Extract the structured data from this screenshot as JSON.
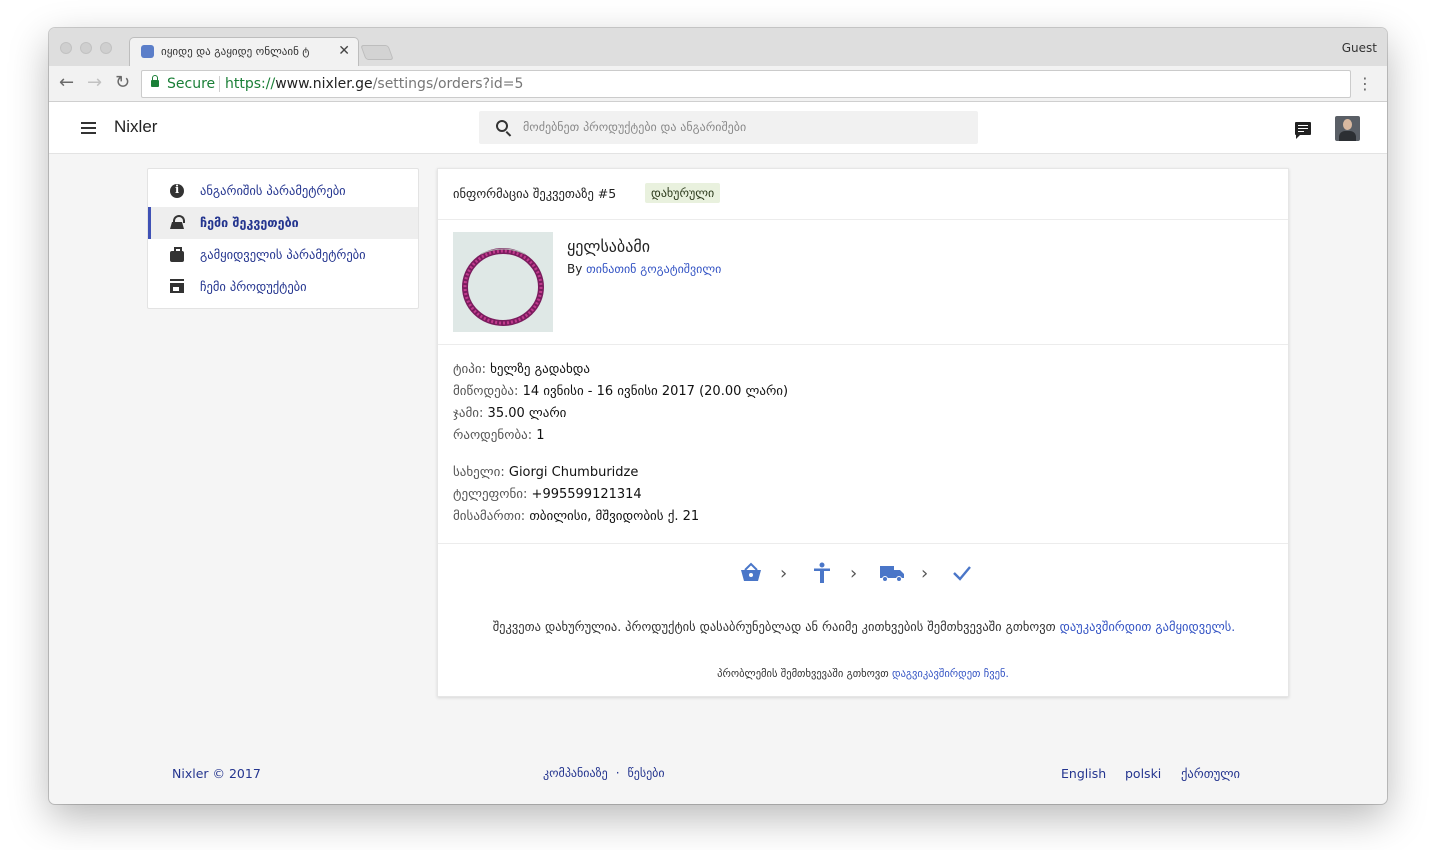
{
  "browser": {
    "tab_title": "იყიდე და გაყიდე ონლაინ ტ",
    "guest_label": "Guest",
    "secure_label": "Secure",
    "url_scheme": "https://",
    "url_host": "www.nixler.ge",
    "url_path": "/settings/orders?id=5"
  },
  "app": {
    "brand": "Nixler",
    "search_placeholder": "მოძებნეთ პროდუქტები და ანგარიშები"
  },
  "sidebar": {
    "items": [
      {
        "label": "ანგარიშის პარამეტრები",
        "icon": "info-icon",
        "active": false
      },
      {
        "label": "ჩემი შეკვეთები",
        "icon": "basket-icon",
        "active": true
      },
      {
        "label": "გამყიდველის პარამეტრები",
        "icon": "briefcase-icon",
        "active": false
      },
      {
        "label": "ჩემი პროდუქტები",
        "icon": "store-icon",
        "active": false
      }
    ]
  },
  "order": {
    "title": "ინფორმაცია შეკვეთაზე #5",
    "status": "დახურული",
    "product_name": "ყელსაბამი",
    "by_label": "By",
    "seller": "თინათინ გოგატიშვილი",
    "type_label": "ტიპი:",
    "type_value": "ხელზე გადახდა",
    "delivery_label": "მიწოდება:",
    "delivery_value": "14 ივნისი - 16 ივნისი 2017 (20.00 ლარი)",
    "total_label": "ჯამი:",
    "total_value": "35.00 ლარი",
    "quantity_label": "რაოდენობა:",
    "quantity_value": "1",
    "name_label": "სახელი:",
    "name_value": "Giorgi Chumburidze",
    "phone_label": "ტელეფონი:",
    "phone_value": "+995599121314",
    "address_label": "მისამართი:",
    "address_value": "თბილისი, მშვიდობის ქ. 21",
    "closed_note": "შეკვეთა დახურულია. პროდუქტის დასაბრუნებლად ან რაიმე კითხვების შემთხვევაში გთხოვთ",
    "contact_seller_link": "დაუკავშირდით გამყიდველს.",
    "help_note": "პრობლემის შემთხვევაში გთხოვთ",
    "help_link": "დაგვიკავშირდეთ ჩვენ.",
    "steps": [
      "basket-icon",
      "person-icon",
      "truck-icon",
      "check-icon"
    ]
  },
  "footer": {
    "copyright": "Nixler © 2017",
    "about": "კომპანიაზე",
    "separator": "·",
    "rules": "წესები",
    "lang_en": "English",
    "lang_pl": "polski",
    "lang_ka": "ქართული"
  },
  "colors": {
    "link": "#3454c4",
    "nav_link": "#24358f",
    "accent": "#3f51b5",
    "status_bg": "#e9f1de",
    "step_icon": "#4a76c8"
  }
}
